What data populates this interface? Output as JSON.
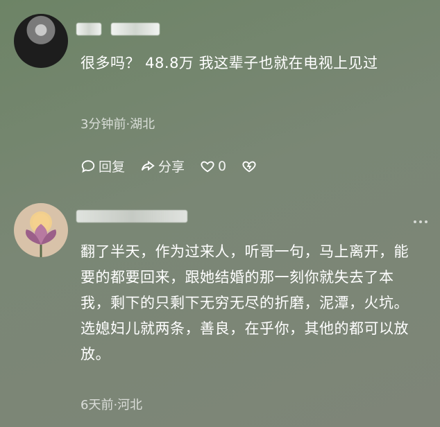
{
  "comments": [
    {
      "text": "很多吗？ 48.8万 我这辈子也就在电视上见过",
      "meta": "3分钟前·湖北",
      "actions": {
        "reply": "回复",
        "share": "分享",
        "like_count": "0"
      }
    },
    {
      "text": "翻了半天，作为过来人，听哥一句，马上离开，能要的都要回来，跟她结婚的那一刻你就失去了本我，剩下的只剩下无穷无尽的折磨，泥潭，火坑。选媳妇儿就两条，善良，在乎你，其他的都可以放放。",
      "meta": "6天前·河北"
    }
  ],
  "icons": [
    "reply-icon",
    "share-icon",
    "heart-icon",
    "dislike-icon",
    "more-icon"
  ]
}
